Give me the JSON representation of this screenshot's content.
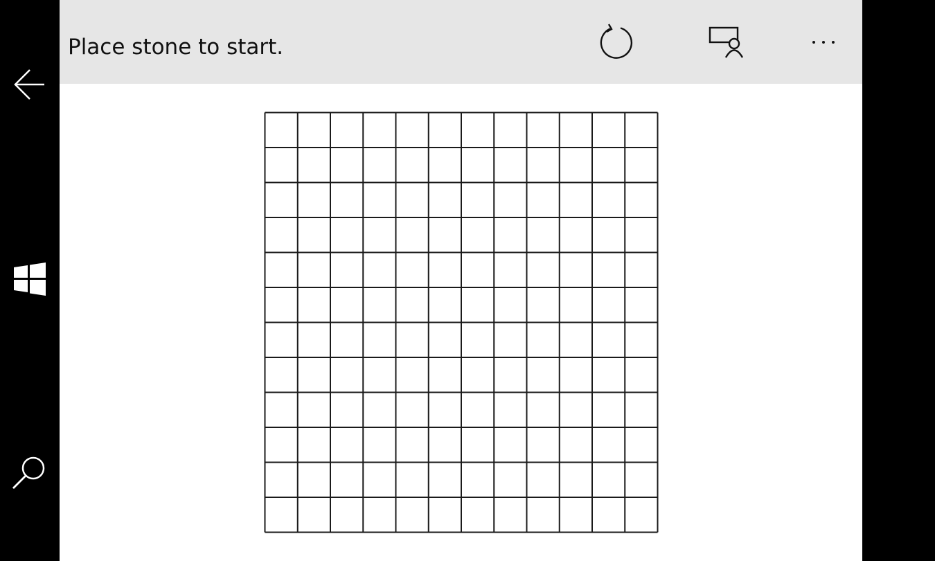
{
  "app": {
    "status_text": "Place stone to start."
  },
  "command_bar": {
    "buttons": [
      {
        "icon": "restart-icon"
      },
      {
        "icon": "player-mode-icon"
      },
      {
        "icon": "more-icon"
      }
    ]
  },
  "navigation": {
    "buttons": [
      {
        "icon": "back-arrow-icon"
      },
      {
        "icon": "windows-start-icon"
      },
      {
        "icon": "search-icon"
      }
    ]
  },
  "board": {
    "columns": 12,
    "rows": 12,
    "stones": []
  },
  "colors": {
    "command_bar_bg": "#e6e6e6",
    "board_line": "#1a1a1a",
    "nav_bg": "#000000",
    "nav_icon": "#ffffff"
  }
}
